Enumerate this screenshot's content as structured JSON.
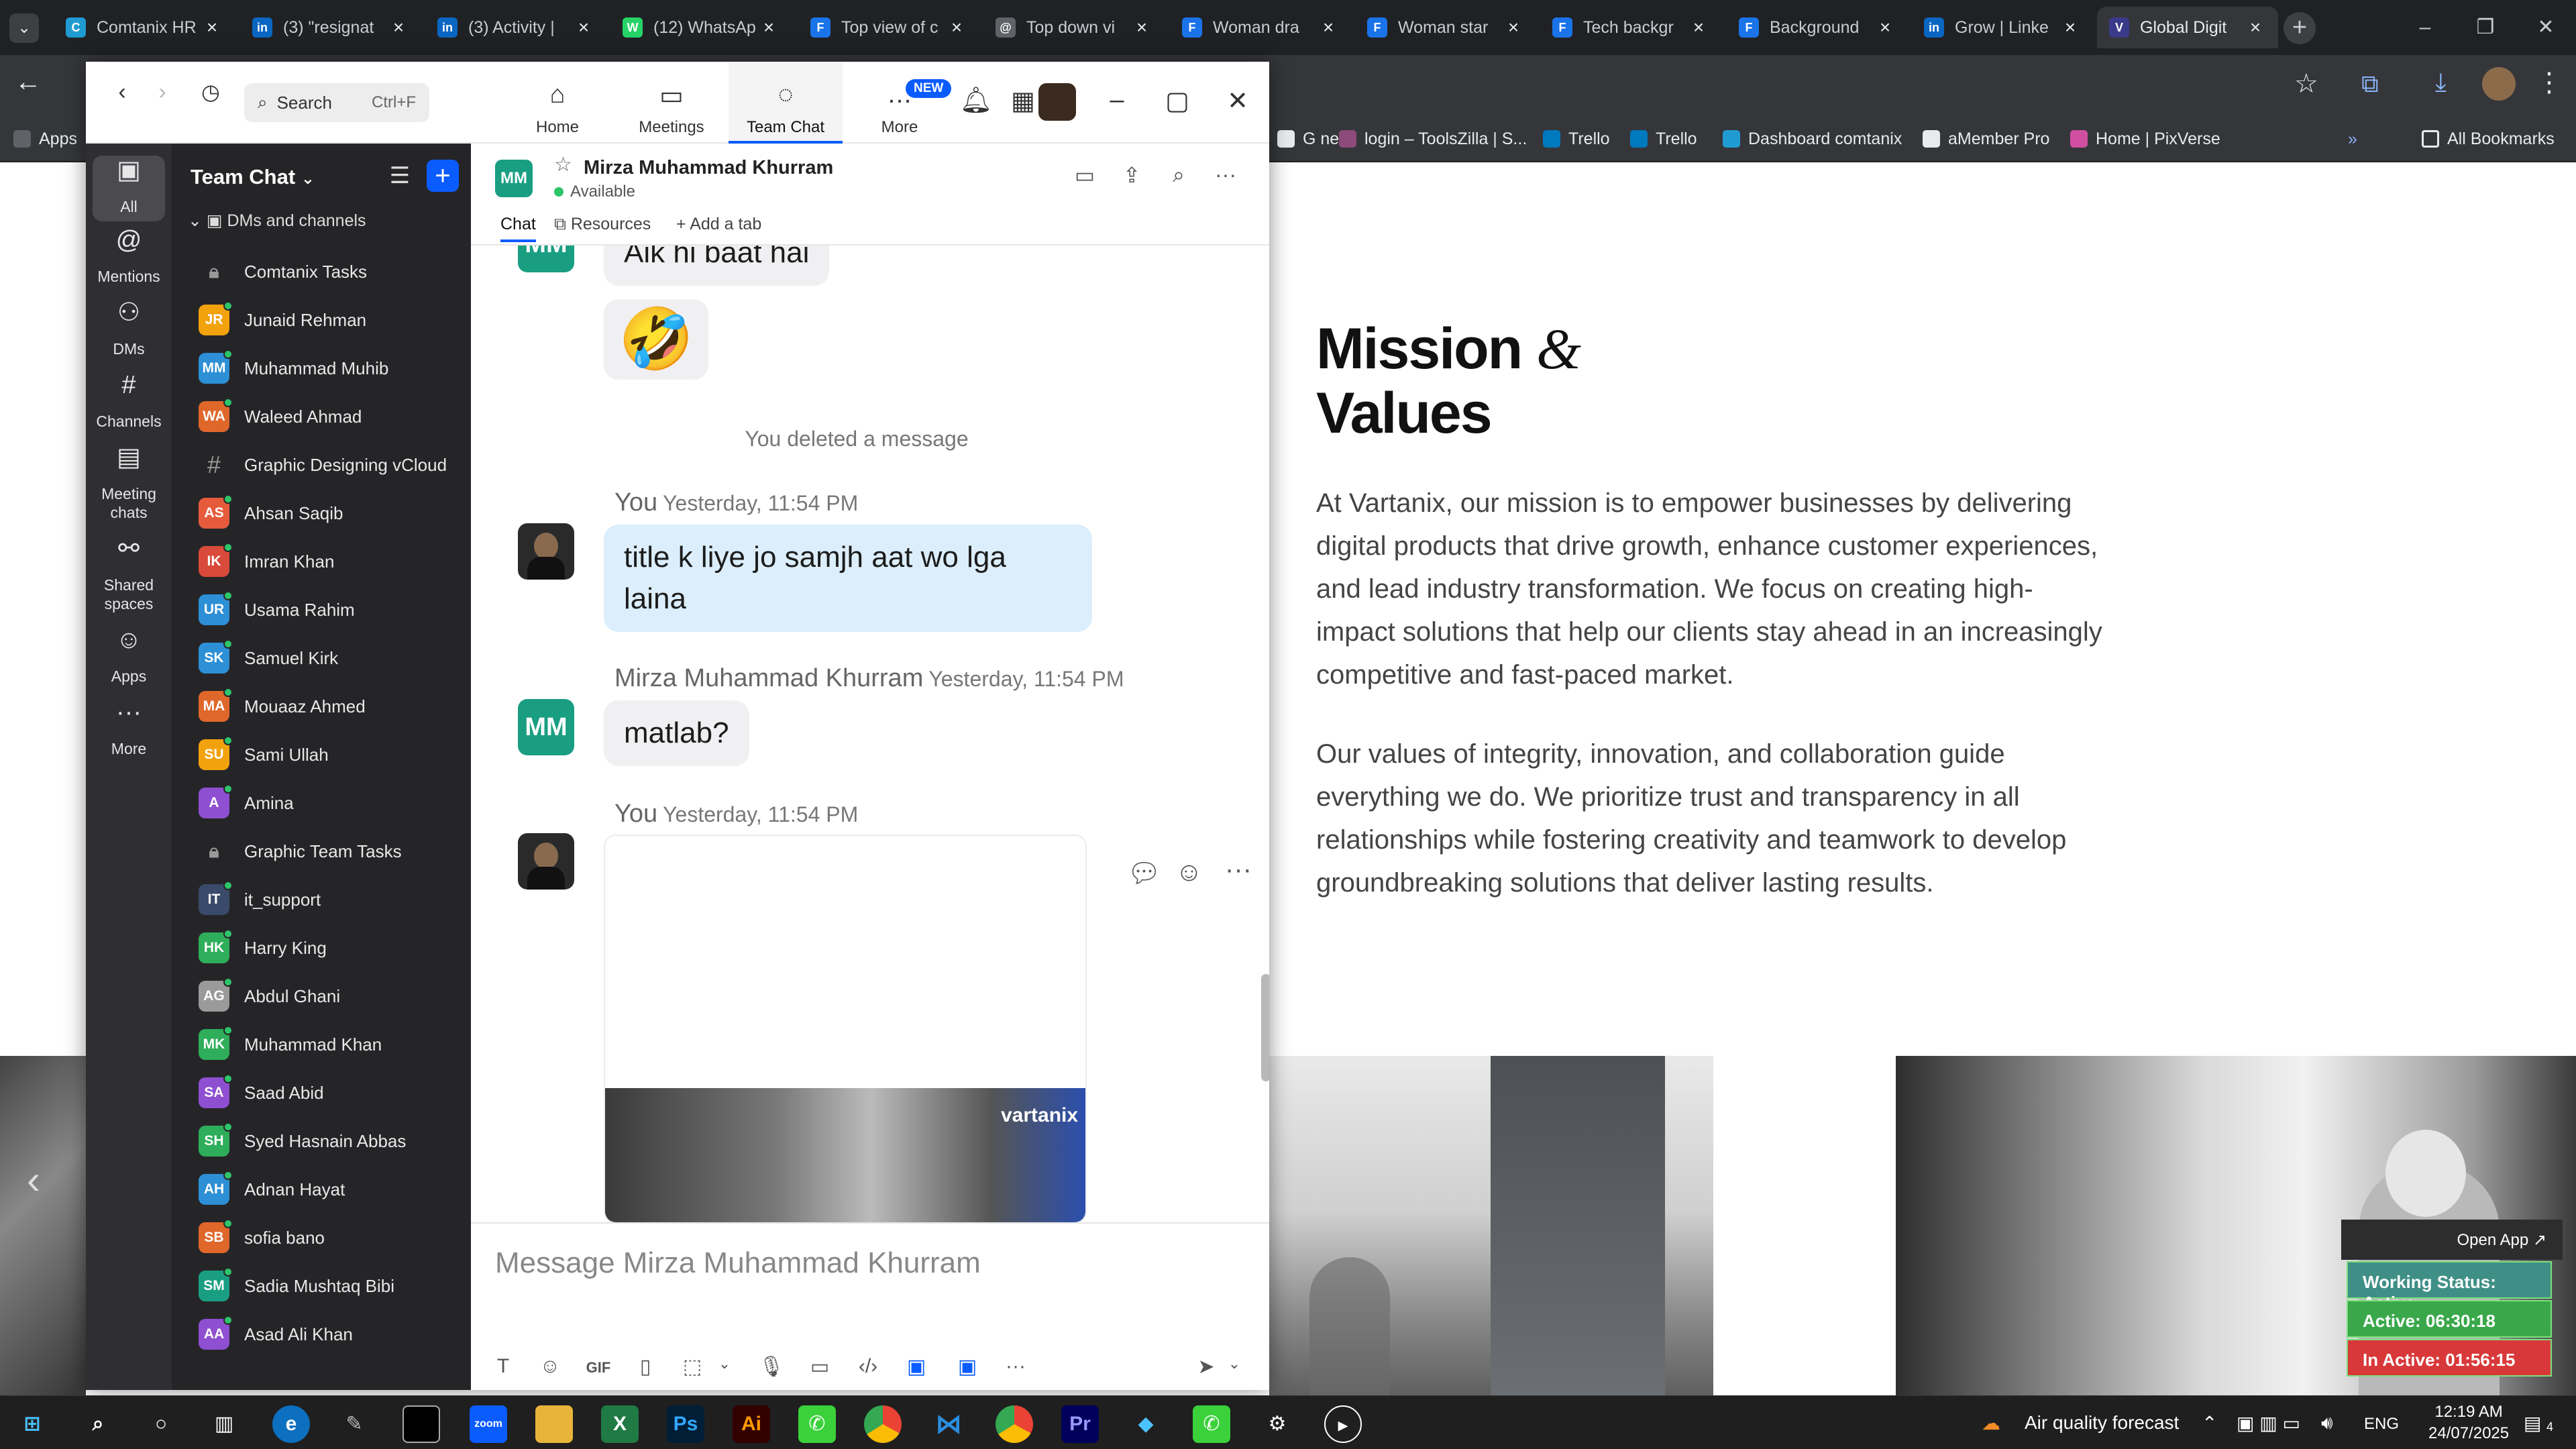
{
  "browser": {
    "tabs": [
      {
        "title": "Comtanix HR",
        "fav": "C",
        "color": "#1f9bd1"
      },
      {
        "title": "(3) \"resignat",
        "fav": "in",
        "color": "#0a66c2"
      },
      {
        "title": "(3) Activity |",
        "fav": "in",
        "color": "#0a66c2"
      },
      {
        "title": "(12) WhatsAp",
        "fav": "W",
        "color": "#25d366"
      },
      {
        "title": "Top view of c",
        "fav": "F",
        "color": "#1a73e8"
      },
      {
        "title": "Top down vi",
        "fav": "@",
        "color": "#5f6368"
      },
      {
        "title": "Woman dra",
        "fav": "F",
        "color": "#1a73e8"
      },
      {
        "title": "Woman star",
        "fav": "F",
        "color": "#1a73e8"
      },
      {
        "title": "Tech backgr",
        "fav": "F",
        "color": "#1a73e8"
      },
      {
        "title": "Background",
        "fav": "F",
        "color": "#1a73e8"
      },
      {
        "title": "Grow | Linke",
        "fav": "in",
        "color": "#0a66c2"
      },
      {
        "title": "Global Digit",
        "fav": "V",
        "color": "#3a3a8a"
      }
    ],
    "active_tab_index": 11,
    "bookmarks": [
      {
        "label": "G new",
        "color": "#e8eaed"
      },
      {
        "label": "login – ToolsZilla | S...",
        "color": "#8d4a7a"
      },
      {
        "label": "Trello",
        "color": "#0079bf"
      },
      {
        "label": "Trello",
        "color": "#0079bf"
      },
      {
        "label": "Dashboard comtanix",
        "color": "#1f9bd1"
      },
      {
        "label": "aMember Pro",
        "color": "#e8eaed"
      },
      {
        "label": "Home | PixVerse",
        "color": "#d04fa0"
      }
    ],
    "bookmarks_apps_label": "Apps",
    "all_bookmarks_label": "All Bookmarks"
  },
  "webpage": {
    "title_line1": "Mission",
    "title_amp": "&",
    "title_line2": "Values",
    "paragraph1": "At Vartanix, our mission is to empower businesses by delivering digital products that drive growth, enhance customer experiences, and lead industry transformation. We focus on creating high-impact solutions that help our clients stay ahead in an increasingly competitive and fast-paced market.",
    "paragraph2": "Our values of integrity, innovation, and collaboration guide everything we do. We prioritize trust and transparency in all relationships while fostering creativity and teamwork to develop groundbreaking solutions that deliver lasting results.",
    "open_app": "Open App ↗",
    "working_status": "Working Status: Active",
    "active_time": "Active: 06:30:18",
    "inactive_time": "In Active: 01:56:15"
  },
  "zoom": {
    "search_placeholder": "Search",
    "search_shortcut": "Ctrl+F",
    "top_tabs": [
      {
        "label": "Home",
        "icon": "⌂"
      },
      {
        "label": "Meetings",
        "icon": "▭"
      },
      {
        "label": "Team Chat",
        "icon": "◌"
      },
      {
        "label": "More",
        "icon": "…"
      }
    ],
    "new_badge": "NEW",
    "rail": [
      {
        "label": "All",
        "icon": "▣"
      },
      {
        "label": "Mentions",
        "icon": "@"
      },
      {
        "label": "DMs",
        "icon": "⚇"
      },
      {
        "label": "Channels",
        "icon": "#"
      },
      {
        "label": "Meeting chats",
        "icon": "▤"
      },
      {
        "label": "Shared spaces",
        "icon": "⚯"
      },
      {
        "label": "Apps",
        "icon": "☺"
      },
      {
        "label": "More",
        "icon": "···"
      }
    ],
    "sidebar_title": "Team Chat",
    "section_label": "DMs and channels",
    "channels": [
      {
        "name": "Comtanix Tasks",
        "kind": "lock"
      },
      {
        "name": "Junaid Rehman",
        "initials": "JR",
        "color": "#f2a20d"
      },
      {
        "name": "Muhammad Muhib",
        "initials": "MM",
        "color": "#2d8fd5"
      },
      {
        "name": "Waleed Ahmad",
        "initials": "WA",
        "color": "#e0672a"
      },
      {
        "name": "Graphic Designing vCloud",
        "kind": "hash"
      },
      {
        "name": "Ahsan Saqib",
        "initials": "AS",
        "color": "#e55b3c"
      },
      {
        "name": "Imran Khan",
        "initials": "IK",
        "color": "#d94a3a"
      },
      {
        "name": "Usama Rahim",
        "initials": "UR",
        "color": "#2d8fd5"
      },
      {
        "name": "Samuel Kirk",
        "initials": "SK",
        "color": "#2d8fd5"
      },
      {
        "name": "Mouaaz Ahmed",
        "initials": "MA",
        "color": "#e0672a"
      },
      {
        "name": "Sami Ullah",
        "initials": "SU",
        "color": "#f2a20d"
      },
      {
        "name": "Amina",
        "initials": "A",
        "color": "#8e4fd0"
      },
      {
        "name": "Graphic Team Tasks",
        "kind": "lock"
      },
      {
        "name": "it_support",
        "initials": "IT",
        "color": "#3a4a6a"
      },
      {
        "name": "Harry King",
        "initials": "HK",
        "color": "#2eae5a"
      },
      {
        "name": "Abdul Ghani",
        "initials": "AG",
        "color": "#9a9a9a"
      },
      {
        "name": "Muhammad Khan",
        "initials": "MK",
        "color": "#2eae5a"
      },
      {
        "name": "Saad Abid",
        "initials": "SA",
        "color": "#8e4fd0"
      },
      {
        "name": "Syed Hasnain Abbas",
        "initials": "SH",
        "color": "#2eae5a"
      },
      {
        "name": "Adnan Hayat",
        "initials": "AH",
        "color": "#2d8fd5"
      },
      {
        "name": "sofia bano",
        "initials": "SB",
        "color": "#e0672a"
      },
      {
        "name": "Sadia Mushtaq Bibi",
        "initials": "SM",
        "color": "#1a9e82"
      },
      {
        "name": "Asad Ali Khan",
        "initials": "AA",
        "color": "#8e4fd0"
      }
    ],
    "chat": {
      "contact_initials": "MM",
      "contact_name": "Mirza Muhammad Khurram",
      "contact_status": "Available",
      "tabs": [
        "Chat",
        "Resources",
        "Add a tab"
      ],
      "msg_partial": "Aik hi baat hai",
      "msg_emoji": "🤣",
      "deleted_notice": "You deleted a message",
      "you_label": "You",
      "time": "Yesterday, 11:54 PM",
      "msg_out1": "title k liye jo samjh aat wo lga laina",
      "other_name": "Mirza Muhammad Khurram",
      "msg_in2": "matlab?",
      "image_brand": "vartanix",
      "composer_placeholder": "Message Mirza Muhammad Khurram"
    }
  },
  "taskbar": {
    "weather": "Air quality forecast",
    "lang": "ENG",
    "time": "12:19 AM",
    "date": "24/07/2025",
    "notifications": "4"
  }
}
